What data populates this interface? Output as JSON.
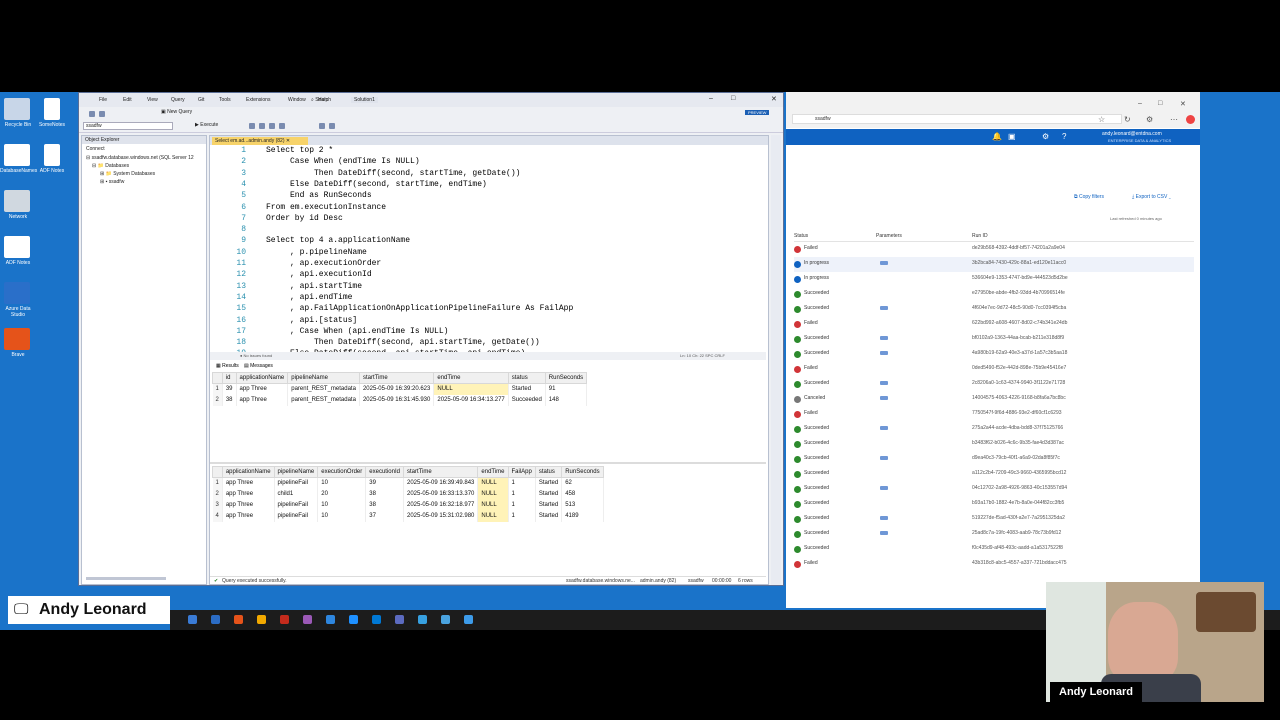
{
  "desktop": {
    "icons": [
      {
        "label": "Recycle Bin",
        "color": "#c8d6e8"
      },
      {
        "label": "DatabaseNames",
        "color": "#ffffff"
      },
      {
        "label": "Network",
        "color": "#d0d8e0"
      },
      {
        "label": "ADF Notes",
        "color": "#ffffff"
      },
      {
        "label": "Azure Data Studio",
        "color": "#2a6fc9"
      },
      {
        "label": "Brave",
        "color": "#e5531a"
      }
    ],
    "icons_col2": [
      {
        "label": "SomeNotes",
        "color": "#ffffff"
      },
      {
        "label": "ADF Notes",
        "color": "#ffffff"
      }
    ]
  },
  "ssms": {
    "menus": [
      "File",
      "Edit",
      "View",
      "Query",
      "Git",
      "Tools",
      "Extensions",
      "Window",
      "Help"
    ],
    "search_label": "Search",
    "solution_label": "Solution1",
    "new_query_label": "New Query",
    "execute_label": "Execute",
    "db_selector": "ssadfw",
    "preview_badge": "PREVIEW",
    "object_explorer": {
      "title": "Object Explorer",
      "connect_label": "Connect",
      "server": "ssadfw.database.windows.net (SQL Server 12",
      "tree": [
        "Databases",
        "System Databases",
        "ssadfw"
      ]
    },
    "tab_title": "Select em.ad...admin.andy (82)",
    "code_lines": [
      {
        "n": "1",
        "text": "Select top 2 *"
      },
      {
        "n": "2",
        "text": "     Case When (endTime Is NULL)"
      },
      {
        "n": "3",
        "text": "          Then DateDiff(second, startTime, getDate())"
      },
      {
        "n": "4",
        "text": "     Else DateDiff(second, startTime, endTime)"
      },
      {
        "n": "5",
        "text": "     End as RunSeconds"
      },
      {
        "n": "6",
        "text": "From em.executionInstance"
      },
      {
        "n": "7",
        "text": "Order by id Desc"
      },
      {
        "n": "8",
        "text": ""
      },
      {
        "n": "9",
        "text": "Select top 4 a.applicationName"
      },
      {
        "n": "10",
        "text": "     , p.pipelineName"
      },
      {
        "n": "11",
        "text": "     , ap.executionOrder"
      },
      {
        "n": "12",
        "text": "     , api.executionId"
      },
      {
        "n": "13",
        "text": "     , api.startTime"
      },
      {
        "n": "14",
        "text": "     , api.endTime"
      },
      {
        "n": "15",
        "text": "     , ap.FailApplicationOnApplicationPipelineFailure As FailApp"
      },
      {
        "n": "16",
        "text": "     , api.[status]"
      },
      {
        "n": "17",
        "text": "     , Case When (api.endTime Is NULL)"
      },
      {
        "n": "18",
        "text": "          Then DateDiff(second, api.startTime, getDate())"
      },
      {
        "n": "19",
        "text": "     Else DateDiff(second, api.startTime, api.endTime)"
      }
    ],
    "editor_status": {
      "issues": "No issues found",
      "position": "Ln: 10  Ch: 22  SPC  CRLF"
    },
    "results_tabs": [
      "Results",
      "Messages"
    ],
    "grid1": {
      "headers": [
        "",
        "id",
        "applicationName",
        "pipelineName",
        "startTime",
        "endTime",
        "status",
        "RunSeconds"
      ],
      "rows": [
        [
          "1",
          "39",
          "app Three",
          "parent_REST_metadata",
          "2025-05-09 16:39:20.623",
          "NULL",
          "Started",
          "91"
        ],
        [
          "2",
          "38",
          "app Three",
          "parent_REST_metadata",
          "2025-05-09 16:31:45.930",
          "2025-05-09 16:34:13.277",
          "Succeeded",
          "148"
        ]
      ]
    },
    "grid2": {
      "headers": [
        "",
        "applicationName",
        "pipelineName",
        "executionOrder",
        "executionId",
        "startTime",
        "endTime",
        "FailApp",
        "status",
        "RunSeconds"
      ],
      "rows": [
        [
          "1",
          "app Three",
          "pipelineFail",
          "10",
          "39",
          "2025-05-09 16:39:49.843",
          "NULL",
          "1",
          "Started",
          "62"
        ],
        [
          "2",
          "app Three",
          "child1",
          "20",
          "38",
          "2025-05-09 16:33:13.370",
          "NULL",
          "1",
          "Started",
          "458"
        ],
        [
          "3",
          "app Three",
          "pipelineFail",
          "10",
          "38",
          "2025-05-09 16:32:18.977",
          "NULL",
          "1",
          "Started",
          "513"
        ],
        [
          "4",
          "app Three",
          "pipelineFail",
          "10",
          "37",
          "2025-05-09 15:31:02.980",
          "NULL",
          "1",
          "Started",
          "4189"
        ]
      ]
    },
    "query_status": {
      "message": "Query executed successfully.",
      "server": "ssadfw.database.windows.ne...",
      "user": "admin.andy (82)",
      "db": "ssadfw",
      "time": "00:00:00",
      "rows": "6 rows"
    }
  },
  "browser": {
    "url": "ssadfw",
    "user_name": "andy.leonard@entdna.com",
    "user_org": "ENTERPRISE DATA & ANALYTICS",
    "copy_filters": "Copy filters",
    "export_csv": "Export to CSV",
    "last_refreshed": "Last refreshed 0 minutes ago",
    "columns": [
      "Status",
      "Parameters",
      "Run ID"
    ],
    "colors": {
      "Failed": "#d13438",
      "In progress": "#0f62c1",
      "Succeeded": "#2d8a2d",
      "Canceled": "#777777"
    },
    "runs": [
      {
        "status": "Failed",
        "params": false,
        "run_id": "de29b568-4392-4ddf-bf57-74201a2a9e04"
      },
      {
        "status": "In progress",
        "params": true,
        "run_id": "3b2bca84-7430-429c-88a1-ed120e11acc0"
      },
      {
        "status": "In progress",
        "params": false,
        "run_id": "536604e9-1353-4747-bd9e-444523d5d2be"
      },
      {
        "status": "Succeeded",
        "params": false,
        "run_id": "e27950be-abde-4fb2-93dd-4b70996514fe"
      },
      {
        "status": "Succeeded",
        "params": true,
        "run_id": "4f604e7ec-9d72-48c5-90d0-7cc0394f5cba"
      },
      {
        "status": "Failed",
        "params": false,
        "run_id": "622bd992-a608-4607-8d02-c74b341e24db"
      },
      {
        "status": "Succeeded",
        "params": true,
        "run_id": "bf0102a9-1363-44aa-bcab-b211e318d8f9"
      },
      {
        "status": "Succeeded",
        "params": true,
        "run_id": "4a980b19-62a9-40e3-a37d-1a57c3b5aa18"
      },
      {
        "status": "Failed",
        "params": false,
        "run_id": "0ded5490-f52e-442d-898e-75b9e45416e7"
      },
      {
        "status": "Succeeded",
        "params": true,
        "run_id": "2c8206a0-1c63-4374-9940-3f1122e71728"
      },
      {
        "status": "Canceled",
        "params": true,
        "run_id": "14004575-4063-4226-9168-b8fa6a7bc8bc"
      },
      {
        "status": "Failed",
        "params": false,
        "run_id": "7750547f-9f6d-4886-93e2-df60cf1c6293"
      },
      {
        "status": "Succeeded",
        "params": true,
        "run_id": "275a2a44-acde-4dba-bdd8-37f75125766"
      },
      {
        "status": "Succeeded",
        "params": false,
        "run_id": "b3483f62-b026-4c6c-9b35-fae4d3d387ac"
      },
      {
        "status": "Succeeded",
        "params": true,
        "run_id": "d9ea40c3-79cb-40f1-a6a9-02da8f85f7c"
      },
      {
        "status": "Succeeded",
        "params": false,
        "run_id": "a112c2b4-7209-49c3-9660-4365995bcd12"
      },
      {
        "status": "Succeeded",
        "params": true,
        "run_id": "04c12702-2a98-4926-9863-40c153557d94"
      },
      {
        "status": "Succeeded",
        "params": false,
        "run_id": "b93a17b0-1882-4e7b-8a0e-044f82cc3fb5"
      },
      {
        "status": "Succeeded",
        "params": true,
        "run_id": "519227de-f5ad-430f-a2e7-7a2951325da2"
      },
      {
        "status": "Succeeded",
        "params": true,
        "run_id": "25ad8c7a-19fc-4083-aab9-78c73b9fd12"
      },
      {
        "status": "Succeeded",
        "params": false,
        "run_id": "f0c435d9-af48-493c-aadd-a1a5317522f8"
      },
      {
        "status": "Failed",
        "params": false,
        "run_id": "43b318c8-abc5-4557-a337-721bddacc475"
      }
    ]
  },
  "overlay": {
    "name_label": "Andy Leonard",
    "cam_name": "Andy Leonard"
  },
  "taskbar_colors": [
    "#3a7bd5",
    "#2b6cc4",
    "#e5531a",
    "#f2a900",
    "#c42b1c",
    "#9b59b6",
    "#2e86de",
    "#1e90ff",
    "#0078d4",
    "#5c6bc0",
    "#37a0e0",
    "#4aa3df",
    "#3d9be9"
  ]
}
